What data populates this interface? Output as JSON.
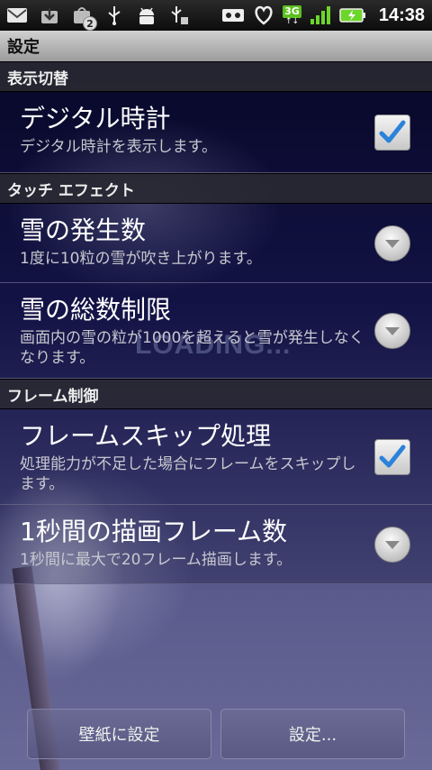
{
  "status_bar": {
    "time": "14:38",
    "network": "3G",
    "notification_badge": "2",
    "icons": [
      "email-icon",
      "download-icon",
      "market-update-icon",
      "usb-icon",
      "android-debug-icon",
      "usb-storage-icon",
      "voicemail-icon",
      "heart-icon",
      "3g-icon",
      "signal-icon",
      "battery-charging-icon"
    ]
  },
  "title": "設定",
  "sections": [
    {
      "header": "表示切替",
      "items": [
        {
          "title": "デジタル時計",
          "summary": "デジタル時計を表示します。",
          "control": "checkbox",
          "checked": true
        }
      ]
    },
    {
      "header": "タッチ エフェクト",
      "items": [
        {
          "title": "雪の発生数",
          "summary": "1度に10粒の雪が吹き上がります。",
          "control": "dropdown"
        },
        {
          "title": "雪の総数制限",
          "summary": "画面内の雪の粒が1000を超えると雪が発生しなくなります。",
          "control": "dropdown"
        }
      ]
    },
    {
      "header": "フレーム制御",
      "items": [
        {
          "title": "フレームスキップ処理",
          "summary": "処理能力が不足した場合にフレームをスキップします。",
          "control": "checkbox",
          "checked": true
        },
        {
          "title": "1秒間の描画フレーム数",
          "summary": "1秒間に最大で20フレーム描画します。",
          "control": "dropdown"
        }
      ]
    }
  ],
  "background_text": "LOADING...",
  "buttons": {
    "set_wallpaper": "壁紙に設定",
    "settings": "設定..."
  },
  "colors": {
    "checkmark": "#2b82d9",
    "background_top": "#0b0b2a",
    "background_bottom": "#6a6a98"
  }
}
